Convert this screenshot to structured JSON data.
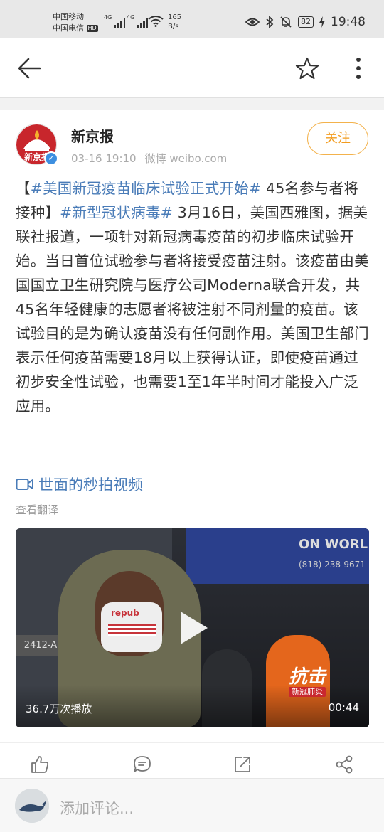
{
  "status_bar": {
    "carrier1": "中国移动",
    "carrier2": "中国电信",
    "hd_badge": "HD",
    "net_tag": "4G",
    "speed_value": "165",
    "speed_unit": "B/s",
    "battery": "82",
    "time": "19:48",
    "icons": [
      "eye-icon",
      "bluetooth-icon",
      "mute-icon",
      "battery-icon",
      "charging-icon",
      "wifi-icon",
      "signal-icon"
    ]
  },
  "nav": {
    "icons": [
      "back-arrow-icon",
      "star-icon",
      "more-vertical-icon"
    ]
  },
  "post": {
    "author": "新京报",
    "time": "03-16 19:10",
    "source": "微博 weibo.com",
    "follow_label": "关注",
    "avatar_text": "新京报",
    "verified_mark": "✓",
    "text": {
      "bracket_open": "【",
      "topic1": "#美国新冠疫苗临床试验正式开始#",
      "part1": " 45名参与者将接种】",
      "topic2": "#新型冠状病毒#",
      "part2": " 3月16日，美国西雅图，据美联社报道，一项针对新冠病毒疫苗的初步临床试验开始。当日首位试验参与者将接受疫苗注射。该疫苗由美国国立卫生研究院与医疗公司Moderna联合开发，共45名年轻健康的志愿者将被注射不同剂量的疫苗。该试验目的是为确认疫苗没有任何副作用。美国卫生部门表示任何疫苗需要18月以上获得认证，即使疫苗通过初步安全性试验，也需要1至1年半时间才能投入广泛应用。"
    },
    "video_link": "世面的秒拍视频",
    "translate": "查看翻译"
  },
  "video": {
    "plays": "36.7万次播放",
    "duration": "00:44",
    "brand_title": "抗击",
    "brand_sub": "新冠肺炎",
    "awning_text": "ON WORL",
    "awning_phone": "(818) 238-9671",
    "street_sign": "2412-A",
    "mask_text": "repub"
  },
  "actions": {
    "icons": [
      "like-icon",
      "comment-icon",
      "repost-icon",
      "share-icon"
    ]
  },
  "comment_bar": {
    "placeholder": "添加评论..."
  }
}
